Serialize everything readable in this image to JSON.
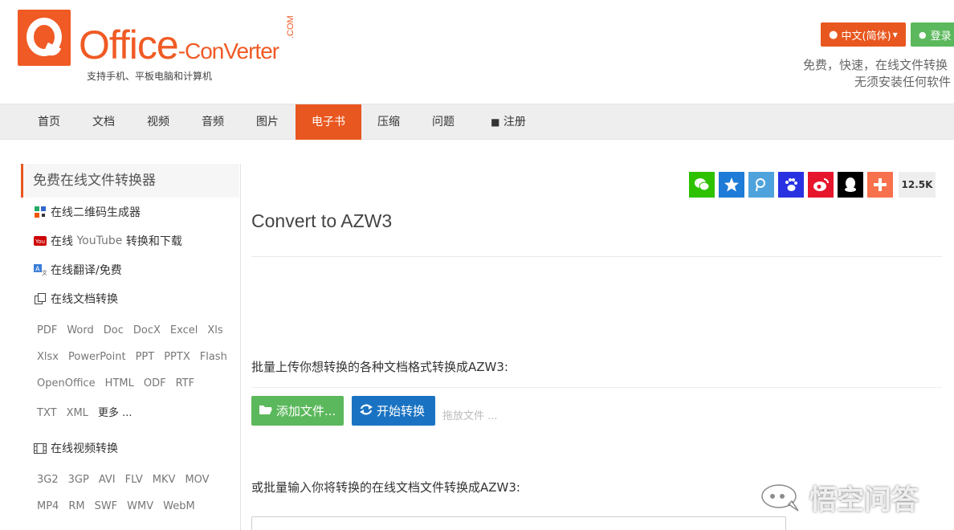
{
  "logo": {
    "brand_main": "Office",
    "brand_dash": "-",
    "brand_sub": "ConVerter",
    "brand_com": ".COM",
    "tagline": "支持手机、平板电脑和计算机",
    "color": "#f05a24"
  },
  "header": {
    "language_label": "中文(简体)",
    "login_label": "登录",
    "slogan_line1": "免费，快速，在线文件转换",
    "slogan_line2": "无须安装任何软件"
  },
  "nav": {
    "items": [
      "首页",
      "文档",
      "视频",
      "音频",
      "图片",
      "电子书",
      "压缩",
      "问题",
      "注册"
    ],
    "active": "电子书",
    "accent_color": "#e8571f"
  },
  "sidebar": {
    "title": "免费在线文件转换器",
    "links": {
      "qrcode": "在线二维码生成器",
      "youtube_prefix": "在线 ",
      "youtube_name": "YouTube",
      "youtube_suffix": " 转换和下载",
      "translate": "在线翻译/免费",
      "document": "在线文档转换",
      "video": "在线视频转换"
    },
    "doc_formats": [
      [
        "PDF",
        "Word",
        "Doc",
        "DocX",
        "Excel",
        "Xls"
      ],
      [
        "Xlsx",
        "PowerPoint",
        "PPT",
        "PPTX",
        "Flash"
      ],
      [
        "OpenOffice",
        "HTML",
        "ODF",
        "RTF"
      ],
      [
        "TXT",
        "XML",
        "更多 ..."
      ]
    ],
    "video_formats": [
      [
        "3G2",
        "3GP",
        "AVI",
        "FLV",
        "MKV",
        "MOV"
      ],
      [
        "MP4",
        "RM",
        "SWF",
        "WMV",
        "WebM"
      ]
    ]
  },
  "share": {
    "count": "12.5K",
    "buttons": [
      {
        "name": "wechat",
        "color": "#2dc100"
      },
      {
        "name": "qzone",
        "color": "#1e7bd7"
      },
      {
        "name": "tencent-weibo",
        "color": "#4fa3dc"
      },
      {
        "name": "baidu",
        "color": "#2932e1"
      },
      {
        "name": "sina-weibo",
        "color": "#e6162d"
      },
      {
        "name": "qq",
        "color": "#000000"
      },
      {
        "name": "more",
        "color": "#f7714c"
      }
    ]
  },
  "main": {
    "title": "Convert to AZW3",
    "batch_upload_label": "批量上传你想转换的各种文档格式转换成AZW3:",
    "add_files_label": "添加文件...",
    "start_convert_label": "开始转换",
    "drop_hint": "拖放文件 ...",
    "batch_url_label": "或批量输入你将转换的在线文档文件转换成AZW3:"
  },
  "watermark": {
    "text": "悟空问答"
  }
}
